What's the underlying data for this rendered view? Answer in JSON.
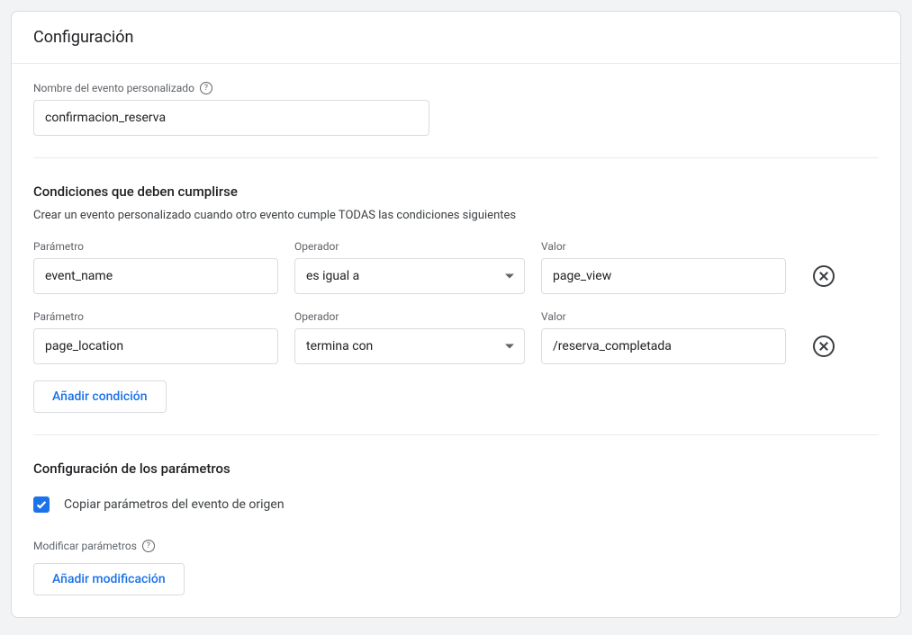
{
  "header": {
    "title": "Configuración"
  },
  "event_name": {
    "label": "Nombre del evento personalizado",
    "value": "confirmacion_reserva"
  },
  "conditions": {
    "title": "Condiciones que deben cumplirse",
    "description": "Crear un evento personalizado cuando otro evento cumple TODAS las condiciones siguientes",
    "column_labels": {
      "parameter": "Parámetro",
      "operator": "Operador",
      "value": "Valor"
    },
    "rows": [
      {
        "parameter": "event_name",
        "operator": "es igual a",
        "value": "page_view"
      },
      {
        "parameter": "page_location",
        "operator": "termina con",
        "value": "/reserva_completada"
      }
    ],
    "add_button": "Añadir condición"
  },
  "parameters": {
    "title": "Configuración de los parámetros",
    "copy_checkbox": {
      "checked": true,
      "label": "Copiar parámetros del evento de origen"
    },
    "modify_label": "Modificar parámetros",
    "add_modification_button": "Añadir modificación"
  }
}
